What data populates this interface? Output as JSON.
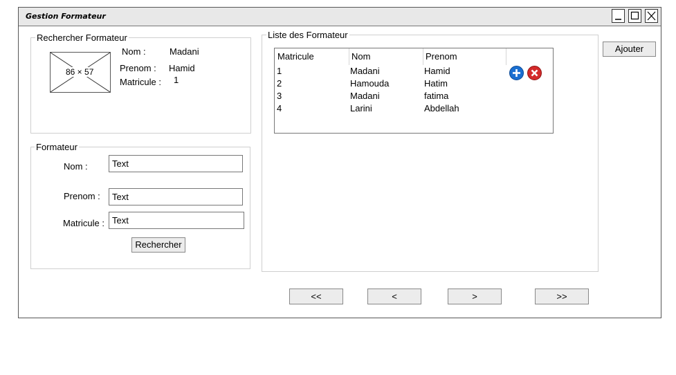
{
  "window": {
    "title": "Gestion Formateur",
    "controls": [
      "minimize-icon",
      "maximize-icon",
      "close-icon"
    ]
  },
  "search_panel": {
    "legend": "Rechercher Formateur",
    "image_placeholder": "86 × 57",
    "nom_label": "Nom :",
    "nom_value": "Madani",
    "prenom_label": "Prenom :",
    "prenom_value": "Hamid",
    "matricule_label": "Matricule :",
    "matricule_value": "1"
  },
  "form_panel": {
    "legend": "Formateur",
    "nom_label": "Nom :",
    "nom_value": "Text",
    "prenom_label": "Prenom :",
    "prenom_value": "Text",
    "matricule_label": "Matricule :",
    "matricule_value": "Text",
    "search_button": "Rechercher"
  },
  "list_panel": {
    "legend": "Liste des Formateur",
    "columns": [
      "Matricule",
      "Nom",
      "Prenom"
    ],
    "rows": [
      {
        "matricule": "1",
        "nom": "Madani",
        "prenom": "Hamid"
      },
      {
        "matricule": "2",
        "nom": "Hamouda",
        "prenom": "Hatim"
      },
      {
        "matricule": "3",
        "nom": "Madani",
        "prenom": "fatima"
      },
      {
        "matricule": "4",
        "nom": "Larini",
        "prenom": "Abdellah"
      }
    ],
    "row_actions": [
      "add-icon",
      "delete-icon"
    ],
    "colors": {
      "add": "#1a6fd1",
      "delete": "#d42a2a"
    }
  },
  "add_button": "Ajouter",
  "pagination": {
    "first": "<<",
    "prev": "<",
    "next": ">",
    "last": ">>"
  }
}
